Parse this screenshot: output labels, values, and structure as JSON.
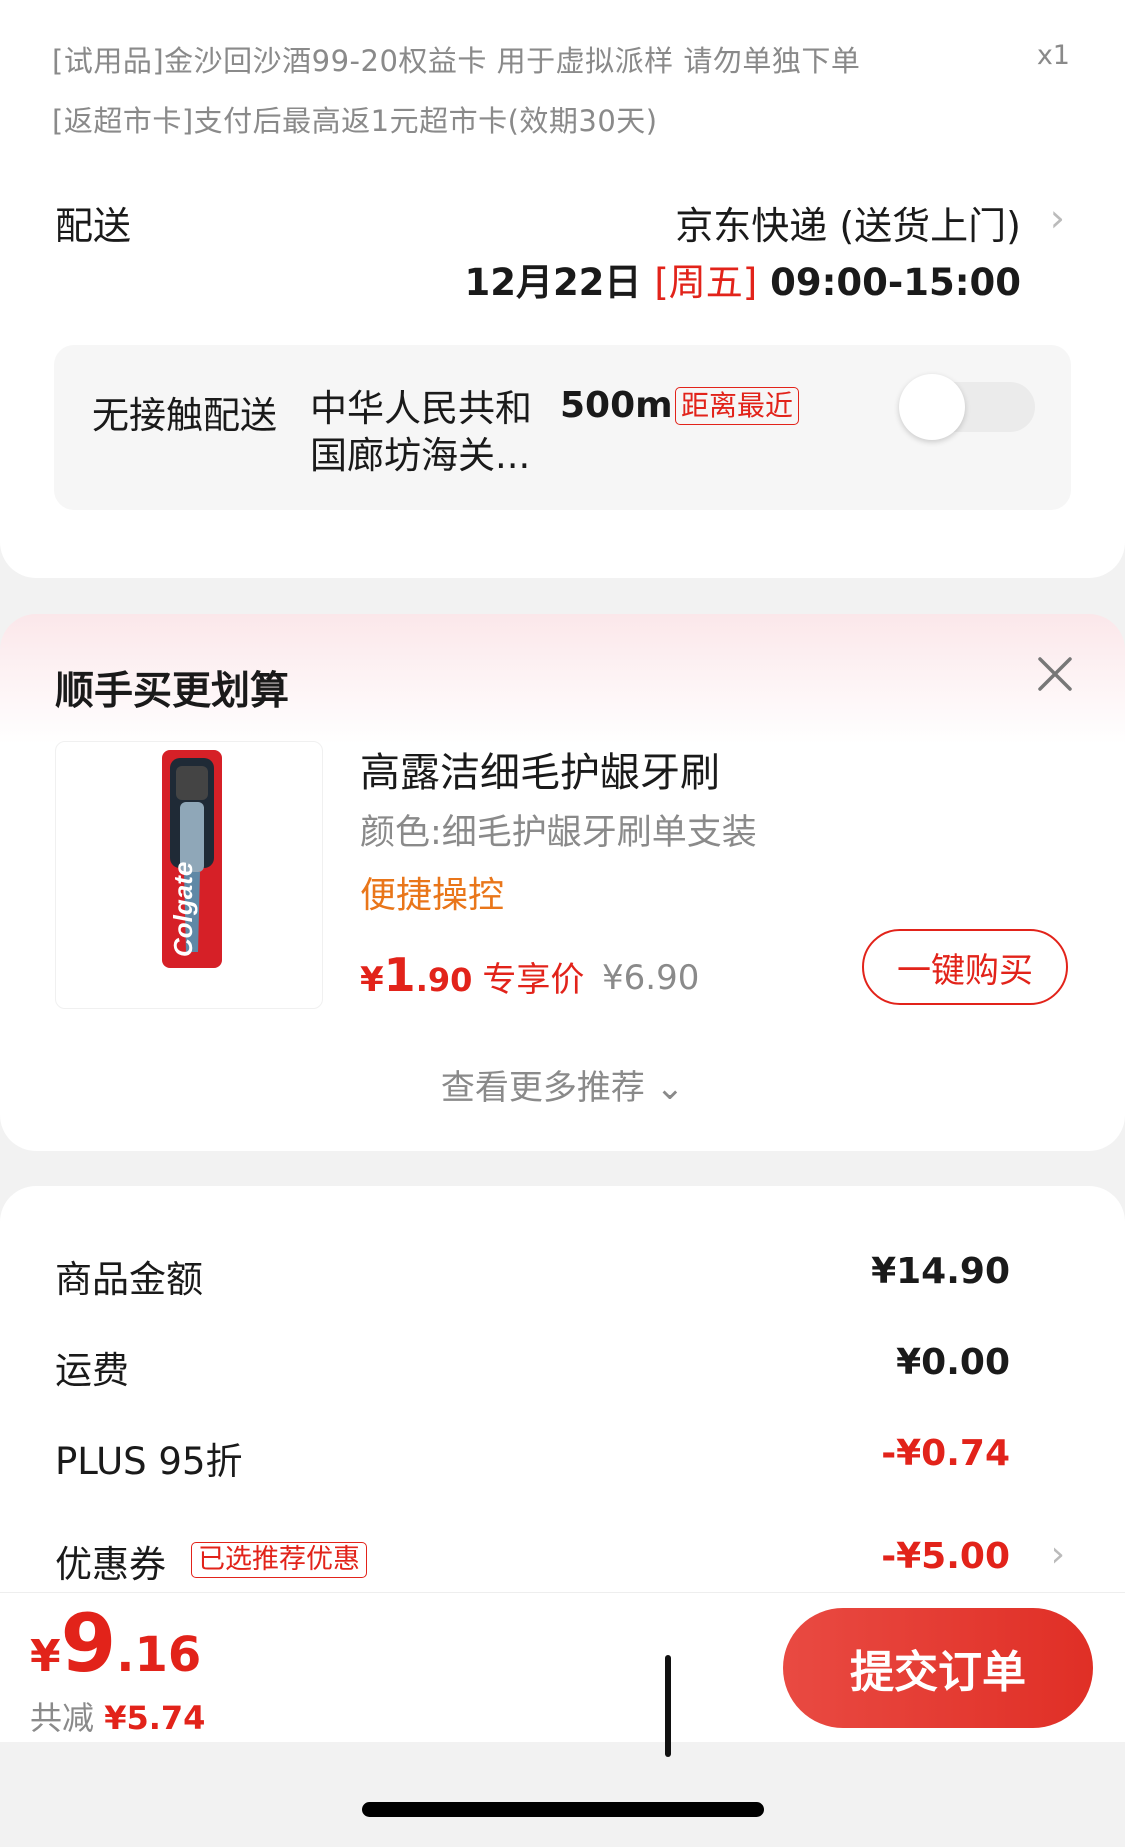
{
  "gifts": {
    "line1": "[试用品]金沙回沙酒99-20权益卡 用于虚拟派样  请勿单独下单",
    "quantity": "x1",
    "line2": "[返超市卡]支付后最高返1元超市卡(效期30天)"
  },
  "shipping": {
    "label": "配送",
    "method": "京东快递 (送货上门)",
    "date": "12月22日",
    "weekday": "[周五]",
    "time_range": "09:00-15:00",
    "chevron": "›"
  },
  "no_contact": {
    "label": "无接触配送",
    "place": "中华人民共和国廊坊海关...",
    "distance": "500m",
    "tag": "距离最近",
    "enabled": false
  },
  "recommend": {
    "title": "顺手买更划算",
    "product": {
      "name": "高露洁细毛护龈牙刷",
      "spec": "颜色:细毛护龈牙刷单支装",
      "tag": "便捷操控",
      "price_symbol": "¥",
      "price_int": "1",
      "price_dec": ".90",
      "price_label": "专享价",
      "original_price": "¥6.90",
      "brand_text": "Colgate",
      "buy_label": "一键购买"
    },
    "more_label": "查看更多推荐 ⌄"
  },
  "summary": {
    "rows": [
      {
        "label": "商品金额",
        "value": "¥14.90"
      },
      {
        "label": "运费",
        "value": "¥0.00"
      },
      {
        "label": "PLUS 95折",
        "value": "-¥0.74"
      },
      {
        "label": "优惠券",
        "value": "-¥5.00",
        "tag": "已选推荐优惠"
      }
    ]
  },
  "bottom": {
    "total_symbol": "¥",
    "total_int": "9",
    "total_dec": ".16",
    "saved_label": "共减",
    "saved_value": "¥5.74",
    "submit_label": "提交订单"
  },
  "colors": {
    "accent": "#e2231a",
    "orange": "#e9761a",
    "muted": "#8a8a8a"
  }
}
